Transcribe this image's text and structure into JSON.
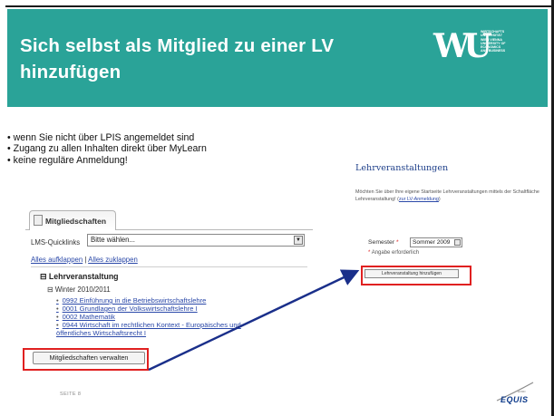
{
  "slide": {
    "title": "Sich selbst als Mitglied zu einer LV hinzufügen",
    "bullets": [
      "• wenn Sie nicht über LPIS angemeldet sind",
      "• Zugang zu allen Inhalten direkt über MyLearn",
      "• keine reguläre Anmeldung!"
    ],
    "page_label": "SEITE 8",
    "colors": {
      "header": "#2aa398",
      "highlight": "#e02020",
      "arrow": "#1a2f8a"
    }
  },
  "logo": {
    "mark": "WU",
    "lines": [
      "WIRTSCHAFTS",
      "UNIVERSITÄT",
      "WIEN VIENNA",
      "UNIVERSITY OF",
      "ECONOMICS",
      "AND BUSINESS"
    ]
  },
  "footer_logo": {
    "text": "EQUIS",
    "sub": "EFMD"
  },
  "left_panel": {
    "tab_label": "Mitgliedschaften",
    "quicklinks_label": "LMS-Quicklinks",
    "quicklinks_value": "Bitte wählen...",
    "expand_all": "Alles aufklappen",
    "separator": "|",
    "collapse_all": "Alles zuklappen",
    "section_header": "⊟ Lehrveranstaltung",
    "term": "⊟ Winter 2010/2011",
    "courses": [
      "0992 Einführung in die Betriebswirtschaftslehre",
      "0001 Grundlagen der Volkswirtschaftslehre I",
      "0002 Mathematik",
      "0944 Wirtschaft im rechtlichen Kontext - Europäisches und",
      "öffentliches Wirtschaftsrecht I"
    ],
    "manage_button": "Mitgliedschaften verwalten"
  },
  "right_panel": {
    "title": "Lehrveranstaltungen",
    "text_before_link": "Möchten Sie über Ihre eigene Startseite Lehrveranstaltungen mittels der Schaltfläche Lehrveranstaltung!",
    "link": "zur LV-Anmeldung",
    "semester_label": "Semester",
    "semester_value": "Sommer 2009",
    "required_note": "Angabe erforderlich",
    "add_button": "Lehrveranstaltung hinzufügen"
  }
}
